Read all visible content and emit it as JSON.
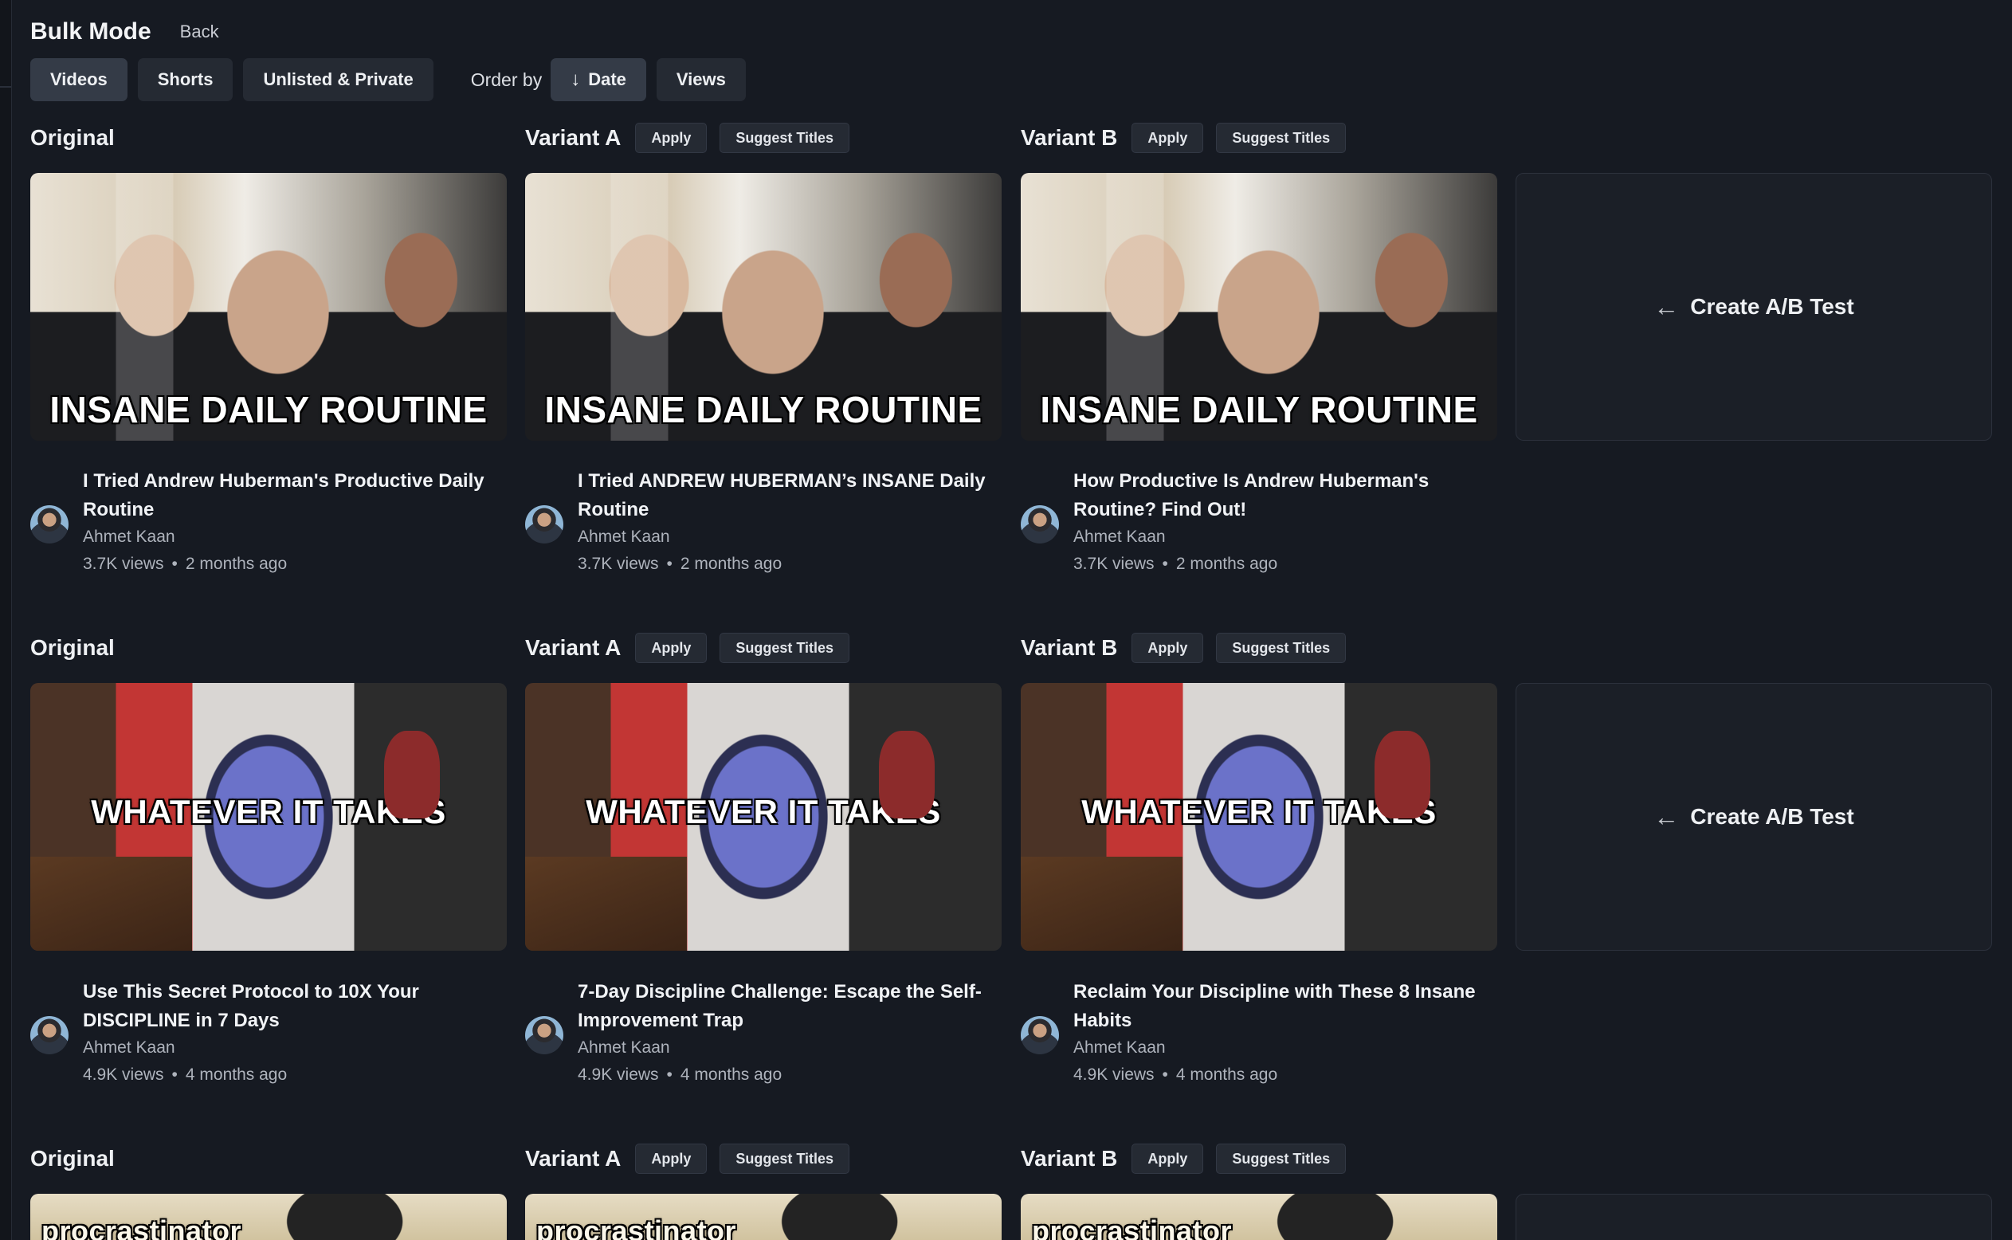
{
  "header": {
    "title": "Bulk Mode",
    "back": "Back"
  },
  "filters": {
    "videos": "Videos",
    "shorts": "Shorts",
    "unlisted": "Unlisted & Private"
  },
  "order": {
    "label": "Order by",
    "date": "Date",
    "views": "Views"
  },
  "labels": {
    "original": "Original",
    "variant_a": "Variant A",
    "variant_b": "Variant B",
    "apply": "Apply",
    "suggest": "Suggest Titles",
    "create": "Create A/B Test"
  },
  "rows": [
    {
      "thumb_text": "INSANE DAILY ROUTINE",
      "channel": "Ahmet Kaan",
      "views": "3.7K views",
      "age": "2 months ago",
      "titles": {
        "original": "I Tried Andrew Huberman's Productive Daily Routine",
        "variant_a": "I Tried ANDREW HUBERMAN’s INSANE Daily Routine",
        "variant_b": "How Productive Is Andrew Huberman's Routine? Find Out!"
      }
    },
    {
      "thumb_text": "WHATEVER IT TAKES",
      "channel": "Ahmet Kaan",
      "views": "4.9K views",
      "age": "4 months ago",
      "titles": {
        "original": "Use This Secret Protocol to 10X Your DISCIPLINE in 7 Days",
        "variant_a": "7-Day Discipline Challenge: Escape the Self-Improvement Trap",
        "variant_b": "Reclaim Your Discipline with These 8 Insane Habits"
      }
    },
    {
      "thumb_text": "procrastinator"
    }
  ]
}
